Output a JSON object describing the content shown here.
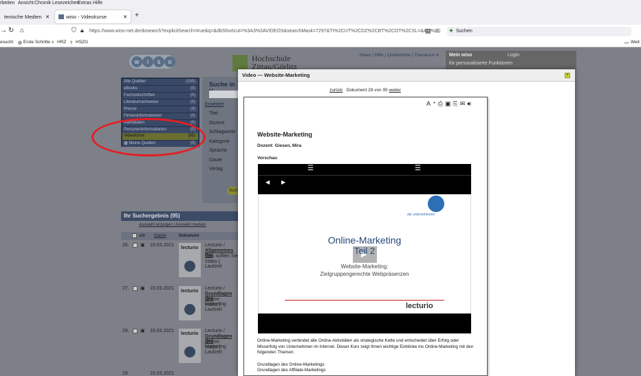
{
  "browser": {
    "menu": [
      "rbeiten",
      "Ansicht",
      "Chronik",
      "Lesezeichen",
      "Extras",
      "Hilfe"
    ],
    "tabs": [
      {
        "label": "tenische Medien"
      },
      {
        "label": "wiso - Videokurse"
      }
    ],
    "new_tab": "+",
    "url": "https://www.wiso-net.de/dosearch?explicitSearch=true&q=&dbShortcut=%3A3%3AVIDEOS&searchMask=7297&TI%2CUT%2CDZ%2CBT%2COT%2CSL=&AU%2C",
    "search_placeholder": "Suchen",
    "bookmarks": [
      "esucht",
      "Erste Schritte",
      "HRZ",
      "HSZG"
    ],
    "bookmarks_right": "Weit"
  },
  "site": {
    "logo_letters": [
      "w",
      "i",
      "s",
      "o"
    ],
    "hs_line1": "Hochschule",
    "hs_line2": "Zittau/Görlitz",
    "top_links": "News | Hilfe | Quellenliste | Thesaurus ▾",
    "mywiso_title": "Mein wiso",
    "mywiso_login": "Login",
    "mywiso_sub": "für personalisierte Funktionen",
    "sources": [
      {
        "label": "Alle Quellen",
        "count": "(100)"
      },
      {
        "label": "eBooks",
        "count": "(0)"
      },
      {
        "label": "Fachzeitschriften",
        "count": "(0)"
      },
      {
        "label": "Literaturnachweise",
        "count": "(0)"
      },
      {
        "label": "Presse",
        "count": "(3)"
      },
      {
        "label": "Firmeninformationen",
        "count": "(0)"
      },
      {
        "label": "Marktdaten",
        "count": "(0)"
      },
      {
        "label": "Personeninformationen",
        "count": "(0)"
      },
      {
        "label": "Videokurse",
        "count": "(95)"
      },
      {
        "label": "Meine Quellen",
        "count": "(0)"
      }
    ],
    "search_title": "Suche in V",
    "search_fields": [
      "Erweitert",
      "Titel",
      "Dozent",
      "Schlagworte",
      "Kategorie",
      "Sprache",
      "Dauer",
      "Verlag"
    ],
    "search_button": "Suche",
    "results_title": "Ihr Suchergebnis (95)",
    "results_links": "Auswahl anzeigen | Auswahl merken",
    "col_all": "alle",
    "col_date": "Datum",
    "col_doc": "Dokument",
    "rows": [
      {
        "num": "26.",
        "date": "19.03.2021",
        "src": "Lecturio /",
        "title": "Allgemeines Gle",
        "line": "Was sollten Sie",
        "dur": "Video ( Laufzeit"
      },
      {
        "num": "27.",
        "date": "19.03.2021",
        "src": "Lecturio /",
        "title": "Grundlagen des",
        "line": "Online-Marketing",
        "dur": "Video ( Laufzeit"
      },
      {
        "num": "28.",
        "date": "19.03.2021",
        "src": "Lecturio /",
        "title": "Grundlagen des",
        "line": "Online-Marketing",
        "dur": "Video ( Laufzeit"
      },
      {
        "num": "29.",
        "date": "19.03.2021",
        "src": "",
        "title": "",
        "line": "",
        "dur": ""
      }
    ]
  },
  "modal": {
    "title": "Video — Website-Marketing",
    "nav_back": "zurück",
    "nav_doc": "Dokument  29 von 95",
    "nav_next": "weiter",
    "doc_title": "Website-Marketing",
    "dozent": "Dozent: Giesen, Mira",
    "preview": "Vorschau",
    "video_title": "Online-Marketing",
    "video_part": "Teil 2",
    "video_sub1": "Website-Marketing:",
    "video_sub2": "Zielgruppengerechte Webpräsenzen",
    "corner_text": "die unternehmerin",
    "lecturio_logo": "lecturio",
    "body_text": "Online-Marketing verbindet alle Online-Aktivitäten als strategische Kette und entscheidet über Erfolg oder Misserfolg von Unternehmen im Internet. Dieser Kurs zeigt Ihnen wichtige Einblicke ins Online-Marketing mit den folgenden Themen:",
    "topic1": "Grundlagen des Online-Marketings",
    "topic2": "Grundlagen des Affiliate-Marketings"
  },
  "colors": {
    "accent": "#c8d437",
    "annotation": "#e41e26",
    "title_blue": "#24467a"
  }
}
